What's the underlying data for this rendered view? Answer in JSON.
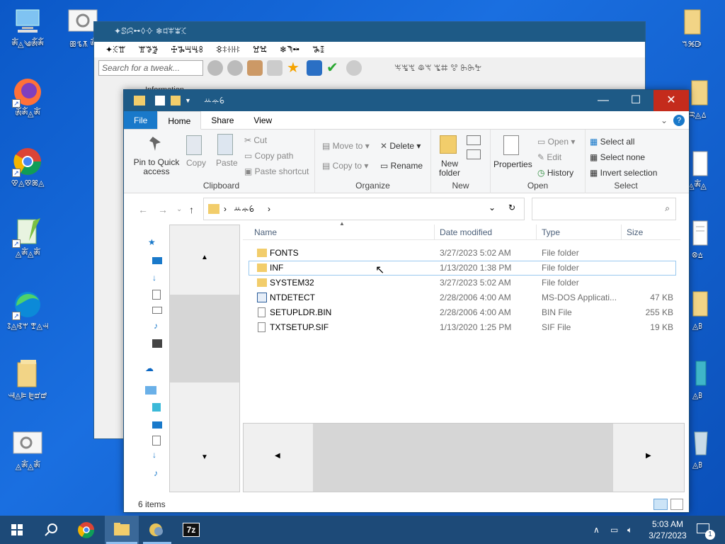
{
  "desktop": {
    "icons": [
      {
        "label": "ༀ◬༄ༀༀ"
      },
      {
        "label": "ꕥꕦꕧ ༀ"
      },
      {
        "label": "ༀༀ◬ༀ"
      },
      {
        "label": "ꕢ◬ꕣꕤ◬"
      },
      {
        "label": "◬ༀ◬ༀ"
      },
      {
        "label": "ꕘ◬ꕙꕚ ꕛ◬ꕜ"
      },
      {
        "label": "ꕝ◬ꕞ ꕟꕠꕡ"
      },
      {
        "label": "◬ༀ◬ༀ"
      },
      {
        "label": "ꕐꕑꕒ"
      },
      {
        "label": "ꕓ◬ꕔ"
      },
      {
        "label": "◬ༀ◬"
      },
      {
        "label": "ꕕꕖ"
      },
      {
        "label": "◬ꕗ"
      },
      {
        "label": "◬ꕗ"
      },
      {
        "label": "◬ꕗ"
      }
    ]
  },
  "bg_window": {
    "title": "✦ꕷꕸꕹꕺꕻ ❄ꕼꕽꕾꕿ",
    "menu": [
      "✦ꖀꖁ",
      "ꖂꖃꖄ",
      "ꖅꖆꖇꖈꖉ",
      "ꖊꖋꖌꖍꖎ",
      "ꖏꖐ",
      "❄ꖑꖒ",
      "ꖓꖔ"
    ],
    "search_placeholder": "Search for a tweak...",
    "toolbar_text": "ꖕꖖꖗ ꖘꖙ ꖚꖛ ꖜ ꖝꖞꖟ",
    "info_label": "Information"
  },
  "explorer": {
    "title": "ꕁꕂꕃ",
    "tabs": {
      "file": "File",
      "home": "Home",
      "share": "Share",
      "view": "View"
    },
    "ribbon": {
      "clipboard": {
        "pin": "Pin to Quick access",
        "copy": "Copy",
        "paste": "Paste",
        "cut": "Cut",
        "copy_path": "Copy path",
        "paste_shortcut": "Paste shortcut",
        "group": "Clipboard"
      },
      "organize": {
        "move_to": "Move to",
        "copy_to": "Copy to",
        "delete": "Delete",
        "rename": "Rename",
        "group": "Organize"
      },
      "new": {
        "new_folder": "New folder",
        "group": "New"
      },
      "open": {
        "properties": "Properties",
        "open": "Open",
        "edit": "Edit",
        "history": "History",
        "group": "Open"
      },
      "select": {
        "select_all": "Select all",
        "select_none": "Select none",
        "invert": "Invert selection",
        "group": "Select"
      }
    },
    "address": {
      "path": "ꕁꕂꕃ"
    },
    "columns": {
      "name": "Name",
      "date": "Date modified",
      "type": "Type",
      "size": "Size"
    },
    "files": [
      {
        "name": "FONTS",
        "date": "3/27/2023 5:02 AM",
        "type": "File folder",
        "size": "",
        "kind": "folder"
      },
      {
        "name": "INF",
        "date": "1/13/2020 1:38 PM",
        "type": "File folder",
        "size": "",
        "kind": "folder"
      },
      {
        "name": "SYSTEM32",
        "date": "3/27/2023 5:02 AM",
        "type": "File folder",
        "size": "",
        "kind": "folder"
      },
      {
        "name": "NTDETECT",
        "date": "2/28/2006 4:00 AM",
        "type": "MS-DOS Applicati...",
        "size": "47 KB",
        "kind": "app"
      },
      {
        "name": "SETUPLDR.BIN",
        "date": "2/28/2006 4:00 AM",
        "type": "BIN File",
        "size": "255 KB",
        "kind": "file"
      },
      {
        "name": "TXTSETUP.SIF",
        "date": "1/13/2020 1:25 PM",
        "type": "SIF File",
        "size": "19 KB",
        "kind": "file"
      }
    ],
    "status": "6 items"
  },
  "taskbar": {
    "time": "5:03 AM",
    "date": "3/27/2023",
    "notif_count": "1",
    "zip_label": "7z"
  },
  "colors": {
    "accent": "#1979ca",
    "titlebar": "#1e5a86",
    "desktop": "#0b58c7",
    "taskbar": "#1d4a78",
    "close": "#c42b1c"
  }
}
